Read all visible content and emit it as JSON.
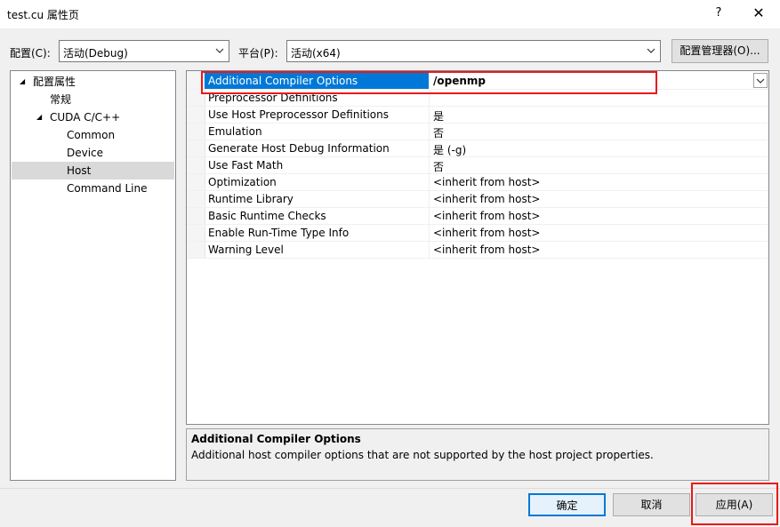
{
  "window": {
    "title": "test.cu 属性页",
    "help": "?",
    "close": "✕"
  },
  "toolbar": {
    "config_label": "配置(C):",
    "config_value": "活动(Debug)",
    "platform_label": "平台(P):",
    "platform_value": "活动(x64)",
    "config_manager": "配置管理器(O)..."
  },
  "tree": {
    "items": [
      {
        "label": "配置属性",
        "expander": "◢",
        "level": 0
      },
      {
        "label": "常规",
        "level": 1
      },
      {
        "label": "CUDA C/C++",
        "expander": "◢",
        "level": 1
      },
      {
        "label": "Common",
        "level": 2
      },
      {
        "label": "Device",
        "level": 2
      },
      {
        "label": "Host",
        "level": 2,
        "selected": true
      },
      {
        "label": "Command Line",
        "level": 2
      }
    ]
  },
  "grid": {
    "rows": [
      {
        "name": "Additional Compiler Options",
        "value": "/openmp",
        "selected": true
      },
      {
        "name": "Preprocessor Definitions",
        "value": ""
      },
      {
        "name": "Use Host Preprocessor Definitions",
        "value": "是"
      },
      {
        "name": "Emulation",
        "value": "否"
      },
      {
        "name": "Generate Host Debug Information",
        "value": "是 (-g)"
      },
      {
        "name": "Use Fast Math",
        "value": "否"
      },
      {
        "name": "Optimization",
        "value": "<inherit from host>"
      },
      {
        "name": "Runtime Library",
        "value": "<inherit from host>"
      },
      {
        "name": "Basic Runtime Checks",
        "value": "<inherit from host>"
      },
      {
        "name": "Enable Run-Time Type Info",
        "value": "<inherit from host>"
      },
      {
        "name": "Warning Level",
        "value": "<inherit from host>"
      }
    ]
  },
  "description": {
    "title": "Additional Compiler Options",
    "text": "Additional host compiler options that are not supported by the host project properties."
  },
  "buttons": {
    "ok": "确定",
    "cancel": "取消",
    "apply": "应用(A)"
  },
  "colors": {
    "selection": "#0078d7",
    "highlight_box": "#e8191b",
    "tree_selection": "#d9d9d9"
  }
}
